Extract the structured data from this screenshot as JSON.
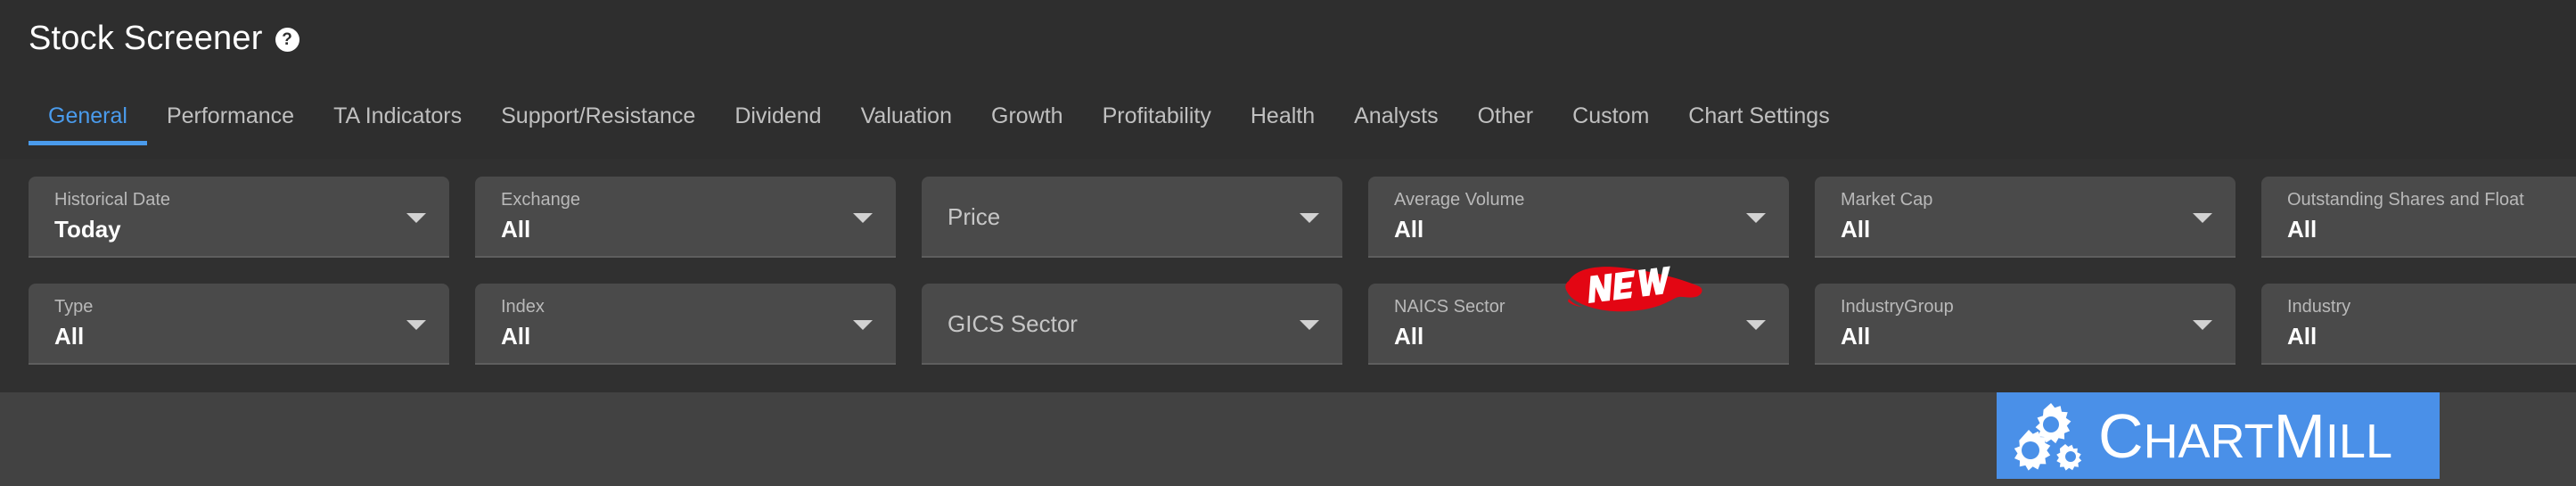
{
  "header": {
    "title": "Stock Screener",
    "help_icon": "question-mark-circle-icon",
    "help_glyph": "?"
  },
  "tabs": [
    {
      "label": "General",
      "active": true
    },
    {
      "label": "Performance",
      "active": false
    },
    {
      "label": "TA Indicators",
      "active": false
    },
    {
      "label": "Support/Resistance",
      "active": false
    },
    {
      "label": "Dividend",
      "active": false
    },
    {
      "label": "Valuation",
      "active": false
    },
    {
      "label": "Growth",
      "active": false
    },
    {
      "label": "Profitability",
      "active": false
    },
    {
      "label": "Health",
      "active": false
    },
    {
      "label": "Analysts",
      "active": false
    },
    {
      "label": "Other",
      "active": false
    },
    {
      "label": "Custom",
      "active": false
    },
    {
      "label": "Chart Settings",
      "active": false
    }
  ],
  "filters": {
    "row1": [
      {
        "label": "Historical Date",
        "value": "Today",
        "filled": true
      },
      {
        "label": "Exchange",
        "value": "All",
        "filled": true
      },
      {
        "label": "Price",
        "value": "",
        "filled": false
      },
      {
        "label": "Average Volume",
        "value": "All",
        "filled": true
      },
      {
        "label": "Market Cap",
        "value": "All",
        "filled": true
      },
      {
        "label": "Outstanding Shares and Float",
        "value": "All",
        "filled": true
      }
    ],
    "row2": [
      {
        "label": "Type",
        "value": "All",
        "filled": true
      },
      {
        "label": "Index",
        "value": "All",
        "filled": true
      },
      {
        "label": "GICS Sector",
        "value": "",
        "filled": false
      },
      {
        "label": "NAICS Sector",
        "value": "All",
        "filled": true
      },
      {
        "label": "IndustryGroup",
        "value": "All",
        "filled": true
      },
      {
        "label": "Industry",
        "value": "All",
        "filled": true
      }
    ]
  },
  "badge": {
    "text": "NEW",
    "color": "#e30613"
  },
  "logo": {
    "text_part1": "C",
    "text_part2": "HART",
    "text_part3": "M",
    "text_part4": "ILL",
    "full_text": "ChartMill",
    "background": "#4a90e8",
    "icon": "gears-icon"
  },
  "colors": {
    "accent": "#4a9bec",
    "panel": "#303030",
    "header": "#2e2e2e",
    "field": "#4a4a4a",
    "footer": "#424242",
    "badge_red": "#e30613",
    "logo_blue": "#4a90e8"
  }
}
